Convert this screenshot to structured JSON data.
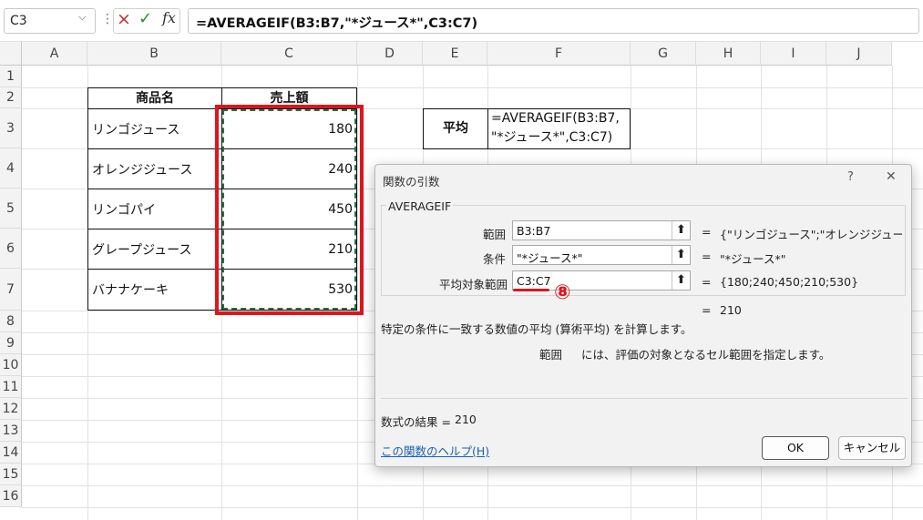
{
  "formula_bar": {
    "name_box": "C3",
    "formula": "=AVERAGEIF(B3:B7,\"*ジュース*\",C3:C7)",
    "fx_label": "fx",
    "cancel_icon": "×",
    "enter_icon": "✓",
    "dots": "⋮"
  },
  "grid": {
    "columns": [
      "A",
      "B",
      "C",
      "D",
      "E",
      "F",
      "G",
      "H",
      "I",
      "J"
    ],
    "rows": [
      "1",
      "2",
      "3",
      "4",
      "5",
      "6",
      "7",
      "8",
      "9",
      "10",
      "11",
      "12",
      "13",
      "14",
      "15",
      "16"
    ]
  },
  "table": {
    "header_name": "商品名",
    "header_sales": "売上額",
    "rows": [
      {
        "name": "リンゴジュース",
        "sales": "180"
      },
      {
        "name": "オレンジジュース",
        "sales": "240"
      },
      {
        "name": "リンゴパイ",
        "sales": "450"
      },
      {
        "name": "グレープジュース",
        "sales": "210"
      },
      {
        "name": "バナナケーキ",
        "sales": "530"
      }
    ]
  },
  "avg_box": {
    "label": "平均",
    "formula_line1": "=AVERAGEIF(B3:B7,",
    "formula_line2": "\"*ジュース*\",C3:C7)"
  },
  "annotation": {
    "step": "⑧"
  },
  "dialog": {
    "title": "関数の引数",
    "help_icon": "?",
    "close_icon": "✕",
    "function_name": "AVERAGEIF",
    "args": [
      {
        "label": "範囲",
        "value": "B3:B7",
        "result": "{\"リンゴジュース\";\"オレンジジュース\";\"..."
      },
      {
        "label": "条件",
        "value": "\"*ジュース*\"",
        "result": "\"*ジュース*\""
      },
      {
        "label": "平均対象範囲",
        "value": "C3:C7",
        "result": "{180;240;450;210;530}"
      }
    ],
    "collapse_icon": "⬆",
    "equals": "=",
    "overall_result": "210",
    "description": "特定の条件に一致する数値の平均 (算術平均) を計算します。",
    "arg_desc_name": "範囲",
    "arg_desc_text": "には、評価の対象となるセル範囲を指定します。",
    "formula_result_label": "数式の結果 =",
    "formula_result_value": "210",
    "help_link": "この関数のヘルプ(H)",
    "ok_label": "OK",
    "cancel_label": "キャンセル"
  },
  "colors": {
    "highlight_red": "#e0141e",
    "marching_ants": "#217346",
    "link_blue": "#1a5fb4"
  }
}
